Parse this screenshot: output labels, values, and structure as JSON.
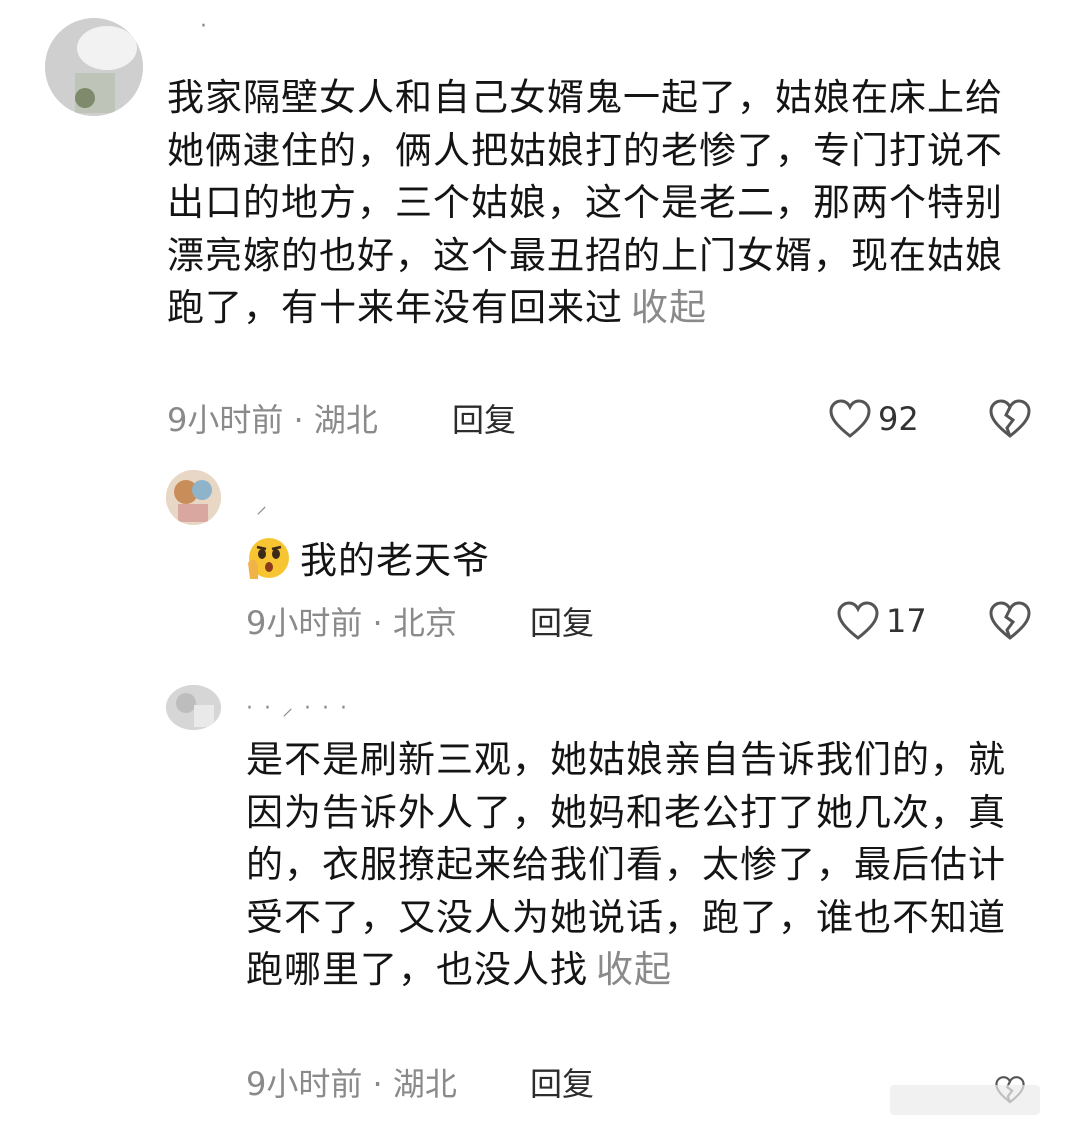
{
  "comments": [
    {
      "username": "·",
      "text": "我家隔壁女人和自己女婿鬼一起了，姑娘在床上给她俩逮住的，俩人把姑娘打的老惨了，专门打说不出口的地方，三个姑娘，这个是老二，那两个特别漂亮嫁的也好，这个最丑招的上门女婿，现在姑娘跑了，有十来年没有回来过",
      "collapse_label": "收起",
      "meta": "9小时前 · 湖北",
      "reply_label": "回复",
      "like_count": "92",
      "icons": {
        "like": "heart-outline-icon",
        "dislike": "broken-heart-icon"
      }
    },
    {
      "username": "⸝",
      "emoji": "shocked-face-emoji",
      "text": "我的老天爷",
      "meta": "9小时前 · 北京",
      "reply_label": "回复",
      "like_count": "17",
      "icons": {
        "like": "heart-outline-icon",
        "dislike": "broken-heart-icon"
      }
    },
    {
      "username": "· · ⸝ · · ·",
      "text": "是不是刷新三观，她姑娘亲自告诉我们的，就因为告诉外人了，她妈和老公打了她几次，真的，衣服撩起来给我们看，太惨了，最后估计受不了，又没人为她说话，跑了，谁也不知道跑哪里了，也没人找",
      "collapse_label": "收起",
      "meta": "9小时前 · 湖北",
      "reply_label": "回复",
      "icons": {
        "dislike": "broken-heart-icon"
      }
    }
  ],
  "colors": {
    "text": "#141414",
    "secondary": "#8a8a8a",
    "icon": "#555555"
  }
}
